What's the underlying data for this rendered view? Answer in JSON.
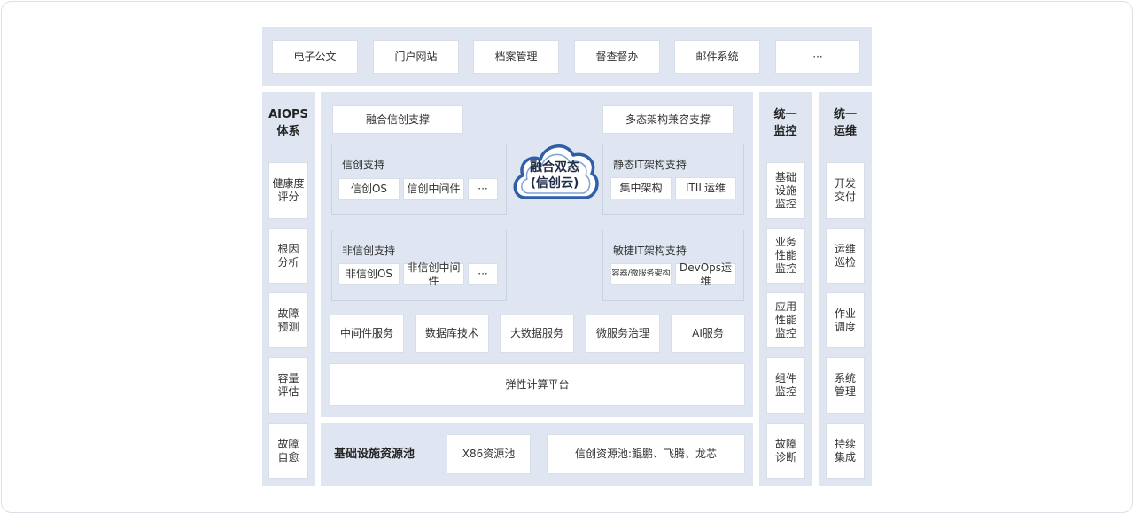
{
  "top_row": [
    "电子公文",
    "门户网站",
    "档案管理",
    "督查督办",
    "邮件系统",
    "···"
  ],
  "aiops": {
    "title_line1": "AIOPS",
    "title_line2": "体系",
    "items": [
      [
        "健康度",
        "评分"
      ],
      [
        "根因",
        "分析"
      ],
      [
        "故障",
        "预测"
      ],
      [
        "容量",
        "评估"
      ],
      [
        "故障",
        "自愈"
      ]
    ]
  },
  "center": {
    "xinchuang_support_btn": "融合信创支撑",
    "multi_arch_btn": "多态架构兼容支撑",
    "cloud_line1": "融合双态",
    "cloud_line2": "(信创云)",
    "xinchuang": {
      "title": "信创支持",
      "items": [
        "信创OS",
        "信创中间件",
        "···"
      ]
    },
    "non_xinchuang": {
      "title": "非信创支持",
      "items": [
        "非信创OS",
        "非信创中间件",
        "···"
      ]
    },
    "static_it": {
      "title": "静态IT架构支持",
      "items": [
        "集中架构",
        "ITIL运维"
      ]
    },
    "agile_it": {
      "title": "敏捷IT架构支持",
      "items": [
        "容器/微服务架构",
        "DevOps运维"
      ]
    },
    "services": [
      "中间件服务",
      "数据库技术",
      "大数据服务",
      "微服务治理",
      "AI服务"
    ],
    "elastic_platform": "弹性计算平台"
  },
  "infra": {
    "title": "基础设施资源池",
    "x86": "X86资源池",
    "xinchuang_pool": "信创资源池:鲲鹏、飞腾、龙芯"
  },
  "monitor": {
    "title_line1": "统一",
    "title_line2": "监控",
    "items": [
      [
        "基础",
        "设施",
        "监控"
      ],
      [
        "业务",
        "性能",
        "监控"
      ],
      [
        "应用",
        "性能",
        "监控"
      ],
      [
        "组件",
        "监控"
      ],
      [
        "故障",
        "诊断"
      ]
    ]
  },
  "ops": {
    "title_line1": "统一",
    "title_line2": "运维",
    "items": [
      [
        "开发",
        "交付"
      ],
      [
        "运维",
        "巡检"
      ],
      [
        "作业",
        "调度"
      ],
      [
        "系统",
        "管理"
      ],
      [
        "持续",
        "集成"
      ]
    ]
  },
  "colors": {
    "panel": "#dfe6f1",
    "cloud_stroke": "#2f5fa8",
    "box": "#ffffff"
  }
}
